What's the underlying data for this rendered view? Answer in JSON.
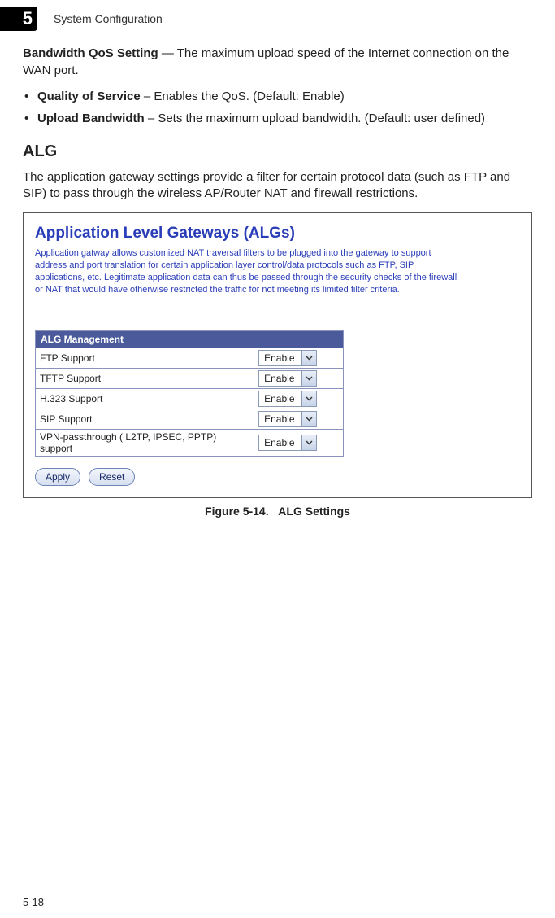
{
  "header": {
    "chapter_number": "5",
    "title": "System Configuration"
  },
  "section1": {
    "title": "Bandwidth QoS Setting",
    "desc": " — The maximum upload speed of the Internet connection on the WAN port.",
    "bullets": [
      {
        "name": "Quality of Service",
        "rest": " – Enables the QoS. (Default: Enable)"
      },
      {
        "name": "Upload Bandwidth",
        "rest": " – Sets the maximum upload bandwidth. (Default: user defined)"
      }
    ]
  },
  "section2": {
    "heading": "ALG",
    "para": "The application gateway settings provide a filter for certain protocol data (such as FTP and SIP) to pass through the wireless AP/Router NAT and firewall restrictions."
  },
  "figure": {
    "panel_title": "Application Level Gateways (ALGs)",
    "panel_desc": "Application gatway allows customized NAT traversal filters to be plugged into the gateway to support address and port translation for certain application layer control/data protocols such as FTP, SIP applications, etc. Legitimate application data can thus be passed through the security checks of the firewall or NAT that would have otherwise restricted the traffic for not meeting its limited filter criteria.",
    "table_header": "ALG Management",
    "rows": [
      {
        "label": "FTP Support",
        "value": "Enable"
      },
      {
        "label": "TFTP Support",
        "value": "Enable"
      },
      {
        "label": "H.323 Support",
        "value": "Enable"
      },
      {
        "label": "SIP Support",
        "value": "Enable"
      },
      {
        "label": "VPN-passthrough ( L2TP, IPSEC, PPTP) support",
        "value": "Enable"
      }
    ],
    "apply_label": "Apply",
    "reset_label": "Reset",
    "caption_prefix": "Figure 5-14.",
    "caption_text": "ALG Settings"
  },
  "page_number": "5-18"
}
